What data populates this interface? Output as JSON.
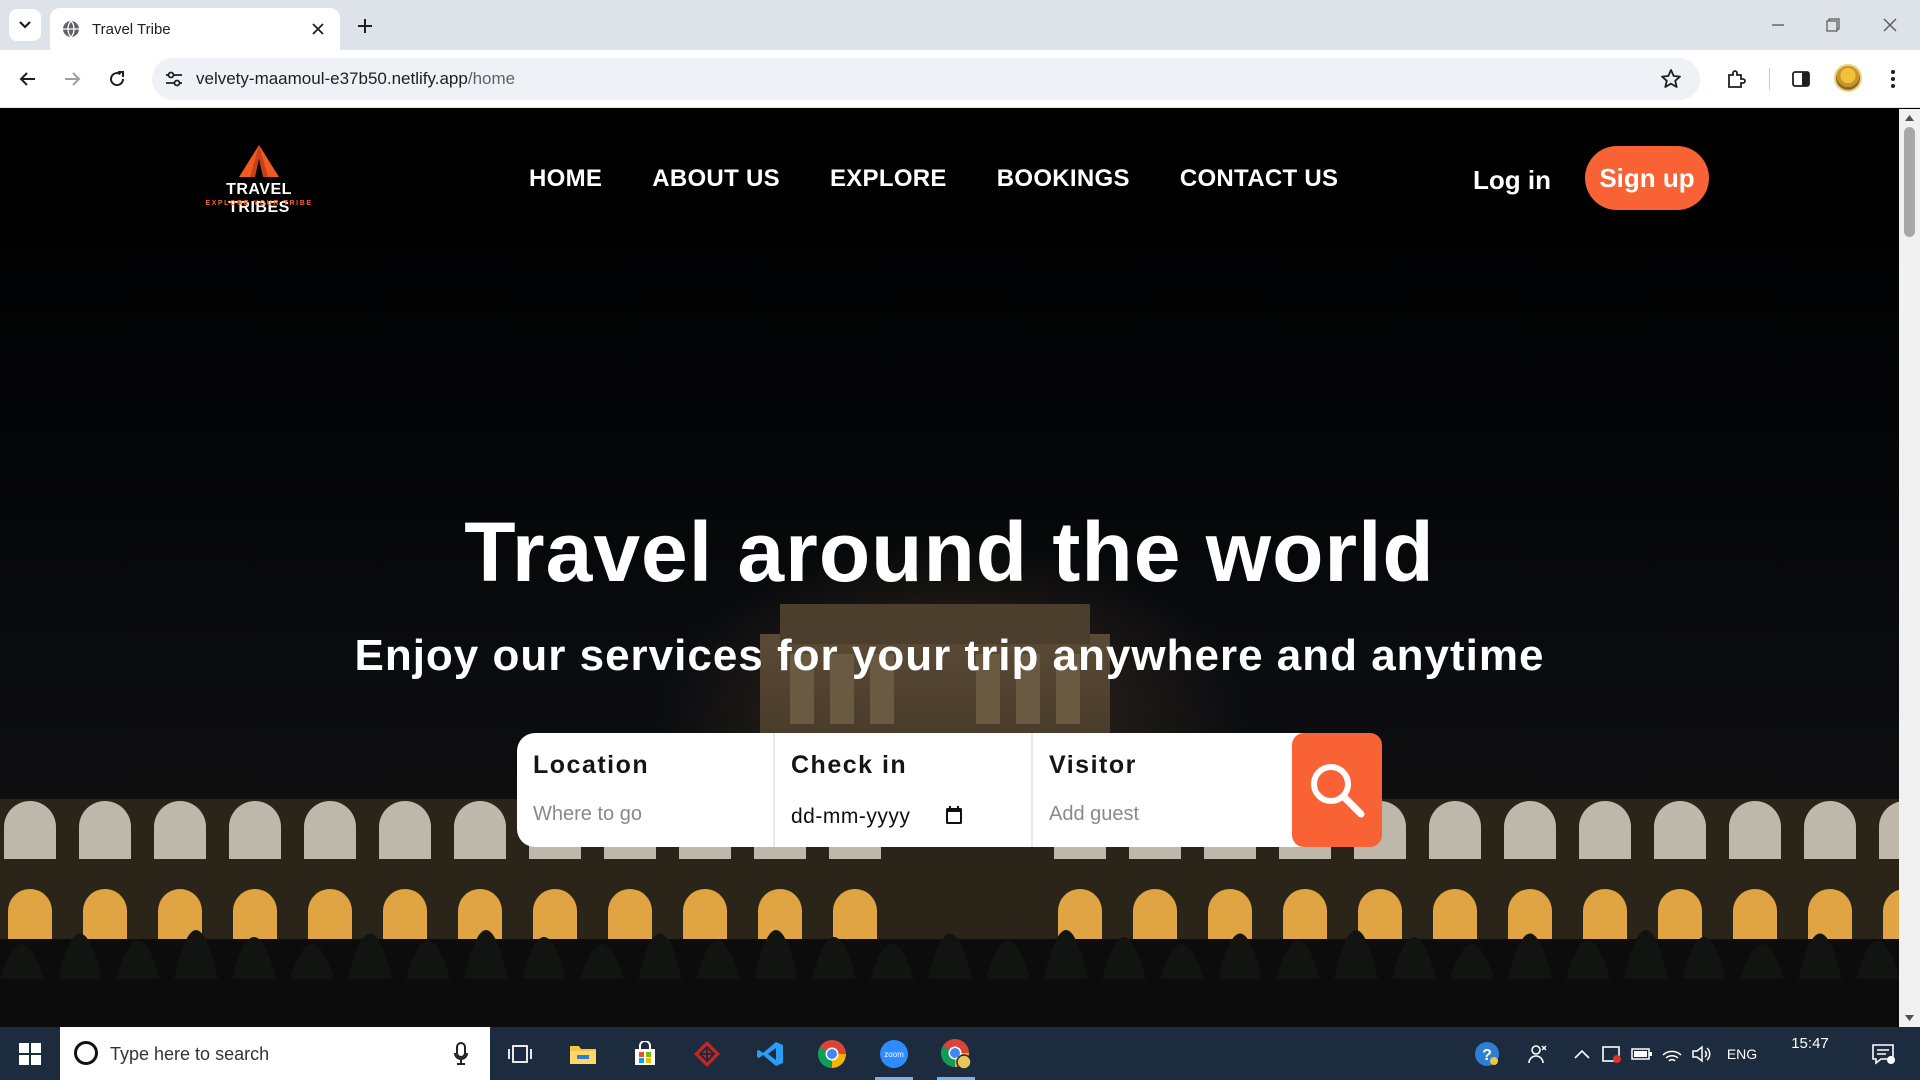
{
  "browser": {
    "tab_title": "Travel Tribe",
    "url_host": "velvety-maamoul-e37b50.netlify.app",
    "url_path": "/home"
  },
  "site": {
    "logo_text": "TRAVEL TRIBES",
    "logo_tagline": "EXPLORE YOUR TRIBE",
    "nav": [
      "HOME",
      "ABOUT US",
      "EXPLORE",
      "BOOKINGS",
      "CONTACT US"
    ],
    "login_label": "Log in",
    "signup_label": "Sign up",
    "hero_title": "Travel around the world",
    "hero_subtitle": "Enjoy our services for your trip anywhere and anytime",
    "search": {
      "location_label": "Location",
      "location_placeholder": "Where to go",
      "checkin_label": "Check in",
      "checkin_value": "dd-mm-yyyy",
      "visitor_label": "Visitor",
      "visitor_placeholder": "Add guest"
    },
    "colors": {
      "accent": "#f96234"
    }
  },
  "taskbar": {
    "search_placeholder": "Type here to search",
    "language": "ENG",
    "time": "15:47",
    "apps": [
      "task-view",
      "file-explorer",
      "microsoft-store",
      "app-red",
      "vs-code",
      "chrome",
      "zoom",
      "chrome-profile"
    ]
  }
}
